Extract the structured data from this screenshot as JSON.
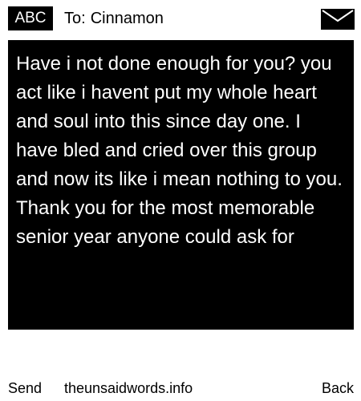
{
  "header": {
    "input_mode": "ABC",
    "to_label": "To:",
    "recipient_name": "Cinnamon",
    "icon": "envelope-icon"
  },
  "message": {
    "body": "Have i not done enough for you? you act like i havent put my whole heart and soul into this since day one. I have bled and cried over this group and now its like i mean nothing to you. Thank you for the most memorable senior year anyone could ask for"
  },
  "footer": {
    "left_softkey": "Send",
    "site": "theunsaidwords.info",
    "right_softkey": "Back"
  },
  "colors": {
    "background": "#ffffff",
    "message_background": "#000000",
    "message_text": "#ffffff"
  }
}
